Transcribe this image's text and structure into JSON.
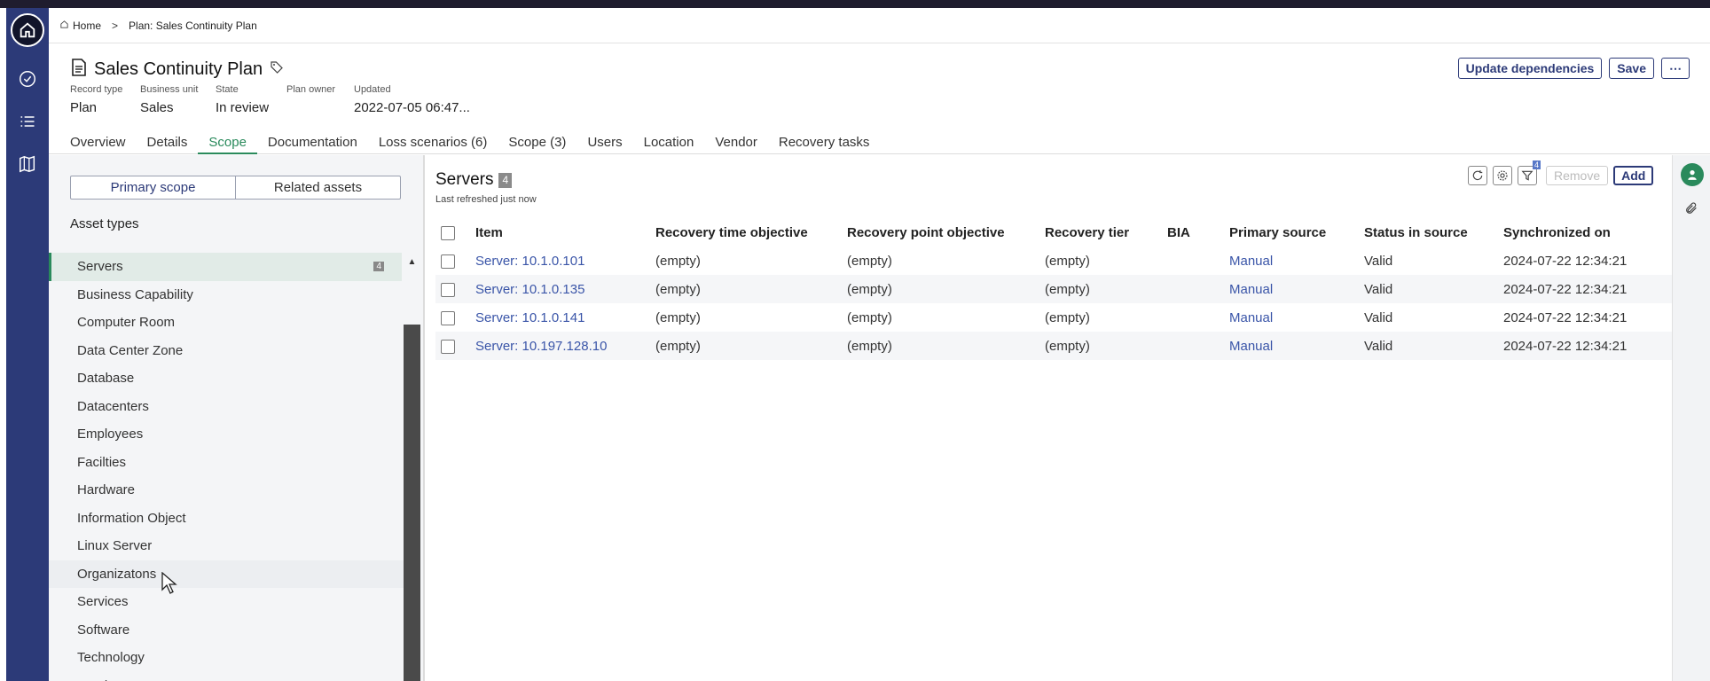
{
  "breadcrumb": {
    "home": "Home",
    "current": "Plan: Sales Continuity Plan"
  },
  "header": {
    "title": "Sales Continuity Plan",
    "meta": [
      {
        "key": "Record type",
        "value": "Plan"
      },
      {
        "key": "Business unit",
        "value": "Sales"
      },
      {
        "key": "State",
        "value": "In review"
      },
      {
        "key": "Plan owner",
        "value": ""
      },
      {
        "key": "Updated",
        "value": "2022-07-05 06:47..."
      }
    ],
    "buttons": {
      "update": "Update dependencies",
      "save": "Save",
      "more": "⋯"
    }
  },
  "tabs": [
    "Overview",
    "Details",
    "Scope",
    "Documentation",
    "Loss scenarios (6)",
    "Scope (3)",
    "Users",
    "Location",
    "Vendor",
    "Recovery tasks"
  ],
  "left": {
    "segments": {
      "primary": "Primary scope",
      "related": "Related assets"
    },
    "asset_types_title": "Asset types",
    "items": [
      "Servers",
      "Business Capability",
      "Computer Room",
      "Data Center Zone",
      "Database",
      "Datacenters",
      "Employees",
      "Facilties",
      "Hardware",
      "Information Object",
      "Linux Server",
      "Organizatons",
      "Services",
      "Software",
      "Technology",
      "Vendors"
    ],
    "selected_count": "4"
  },
  "main": {
    "title": "Servers",
    "count": "4",
    "refreshed": "Last refreshed just now",
    "remove_label": "Remove",
    "add_label": "Add",
    "filter_badge": "4",
    "columns": [
      "Item",
      "Recovery time objective",
      "Recovery point objective",
      "Recovery tier",
      "BIA",
      "Primary source",
      "Status in source",
      "Synchronized on"
    ],
    "rows": [
      {
        "item": "Server: 10.1.0.101",
        "rto": "(empty)",
        "rpo": "(empty)",
        "tier": "(empty)",
        "bia": "",
        "source": "Manual",
        "status": "Valid",
        "sync": "2024-07-22 12:34:21"
      },
      {
        "item": "Server: 10.1.0.135",
        "rto": "(empty)",
        "rpo": "(empty)",
        "tier": "(empty)",
        "bia": "",
        "source": "Manual",
        "status": "Valid",
        "sync": "2024-07-22 12:34:21"
      },
      {
        "item": "Server: 10.1.0.141",
        "rto": "(empty)",
        "rpo": "(empty)",
        "tier": "(empty)",
        "bia": "",
        "source": "Manual",
        "status": "Valid",
        "sync": "2024-07-22 12:34:21"
      },
      {
        "item": "Server: 10.197.128.10",
        "rto": "(empty)",
        "rpo": "(empty)",
        "tier": "(empty)",
        "bia": "",
        "source": "Manual",
        "status": "Valid",
        "sync": "2024-07-22 12:34:21"
      }
    ]
  },
  "colors": {
    "rail": "#2c3a78",
    "accent": "#2a8a5c",
    "link": "#3a55a8"
  }
}
